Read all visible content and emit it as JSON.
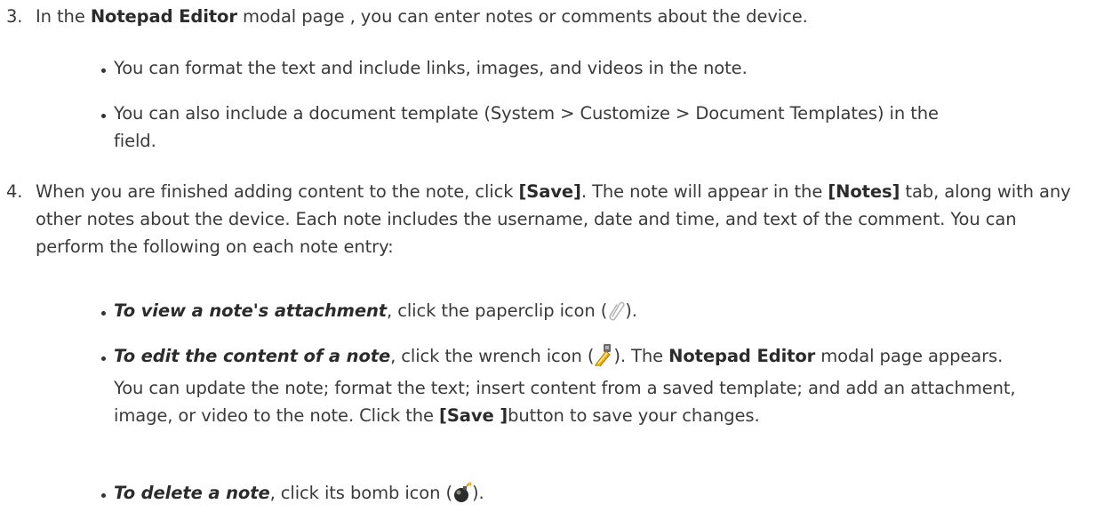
{
  "steps": [
    {
      "number": "3.",
      "pre": "In the ",
      "bold1": "Notepad Editor",
      "post": " modal page , you can enter notes or comments about the device.",
      "bullets": [
        "You can format the text and include links, images, and videos in the note.",
        "You can also include a document template (System > Customize > Document Templates) in the field."
      ]
    },
    {
      "number": "4.",
      "t1": "When you are finished adding content to the note, click ",
      "b1": "[Save]",
      "t2": ". The note will appear in the ",
      "b2": "[Notes]",
      "t3": " tab, along with any other notes about the device. Each note includes the username, date and time, and text of the comment. You can perform the following on each note entry:",
      "bullets": [
        {
          "lead": "To view a note's attachment",
          "text1": ", click the paperclip icon (",
          "icon": "paperclip-icon",
          "text2": ")."
        },
        {
          "lead": "To edit the content of a note",
          "text1": ", click the wrench icon (",
          "icon": "wrench-icon",
          "text2": "). The ",
          "bold": "Notepad Editor",
          "text3": " modal page appears. You can update the note; format the text; insert content from a saved template; and add an attachment, image, or video to the note. Click the ",
          "bold2": "[Save ]",
          "text4": "button to save your changes."
        },
        {
          "lead": "To delete a note",
          "text1": ", click its bomb icon (",
          "icon": "bomb-icon",
          "text2": ")."
        }
      ]
    }
  ]
}
